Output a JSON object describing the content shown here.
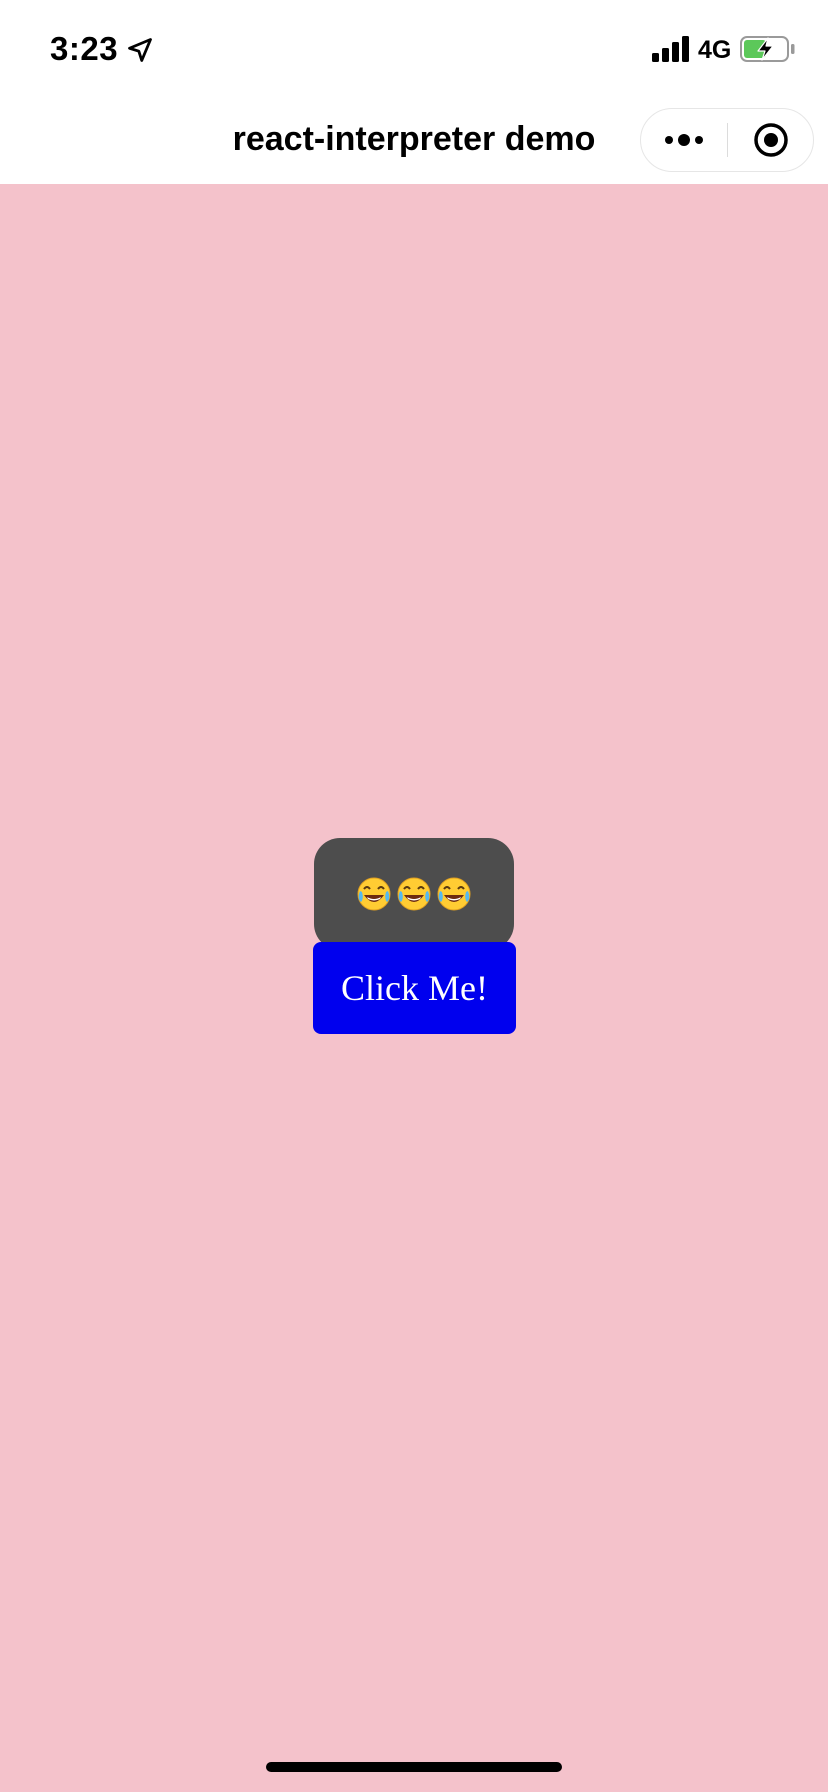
{
  "status_bar": {
    "time": "3:23",
    "network": "4G",
    "location_icon": "location-arrow-icon",
    "signal_icon": "cellular-signal-icon",
    "battery_icon": "battery-charging-icon"
  },
  "nav_bar": {
    "title": "react-interpreter demo",
    "more_icon": "more-dots-icon",
    "close_icon": "target-circle-icon"
  },
  "content": {
    "background_color": "#f4c2cb",
    "emoji_count": 3,
    "emoji_icon": "tears-of-joy-emoji-icon",
    "emoji_box_color": "#4d4d4d",
    "button_label": "Click Me!",
    "button_color": "#0000ee"
  }
}
